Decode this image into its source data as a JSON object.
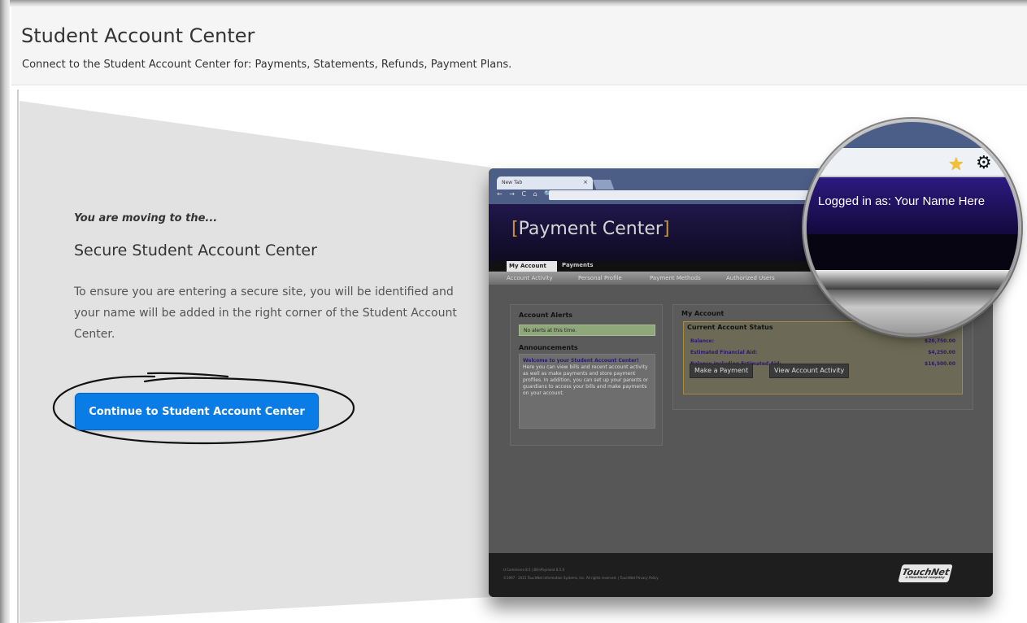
{
  "header": {
    "title": "Student Account Center",
    "subtitle": "Connect to the Student Account Center for: Payments, Statements, Refunds, Payment Plans."
  },
  "main": {
    "moving_text": "You are moving to the...",
    "secure_title": "Secure Student Account Center",
    "description": "To ensure you are entering a secure site, you will be identified and your name will be added in the right corner of the Student Account Center.",
    "continue_button": "Continue to Student Account Center"
  },
  "preview": {
    "browser_tab": "New Tab",
    "browser_tab_close": "×",
    "nav_icons": "← → C ⌂ 🔍",
    "brand_open": "[",
    "brand_name": "Payment Center",
    "brand_close": "]",
    "tabs": [
      "My Account",
      "Payments"
    ],
    "subnav": [
      "Account Activity",
      "Personal Profile",
      "Payment Methods",
      "Authorized Users"
    ],
    "alerts_title": "Account Alerts",
    "alerts_text": "No alerts at this time.",
    "announcements_title": "Announcements",
    "announcement_heading": "Welcome to your Student Account Center!",
    "announcement_body": "Here you can view bills and recent account activity as well as make payments and store payment profiles. In addition, you can set up your parents or guardians to access your bills and make payments on your account.",
    "my_account_title": "My Account",
    "status_title": "Current Account Status",
    "balance_label": "Balance:",
    "balance_value": "$20,750.00",
    "aid_label": "Estimated Financial Aid:",
    "aid_value": "$4,250.00",
    "incl_label": "Balance Including Estimated Aid:",
    "incl_value": "$16,500.00",
    "make_payment": "Make a Payment",
    "view_activity": "View Account Activity",
    "footer_line1": "U.Commerce 8.5 | BillnPayment 8.5.0",
    "footer_line2": "©1997 - 2015 TouchNet Information Systems, Inc. All rights reserved. | TouchNet Privacy Policy",
    "footer_logo": "TouchNet",
    "footer_logo_sub": "a Heartland company"
  },
  "magnifier": {
    "logged_in_text": "Logged in as: Your Name Here",
    "star_icon": "star-icon",
    "gear_icon": "gear-icon"
  },
  "colors": {
    "accent_button": "#0a7ce6",
    "wedge_gray": "#e2e2e2"
  }
}
